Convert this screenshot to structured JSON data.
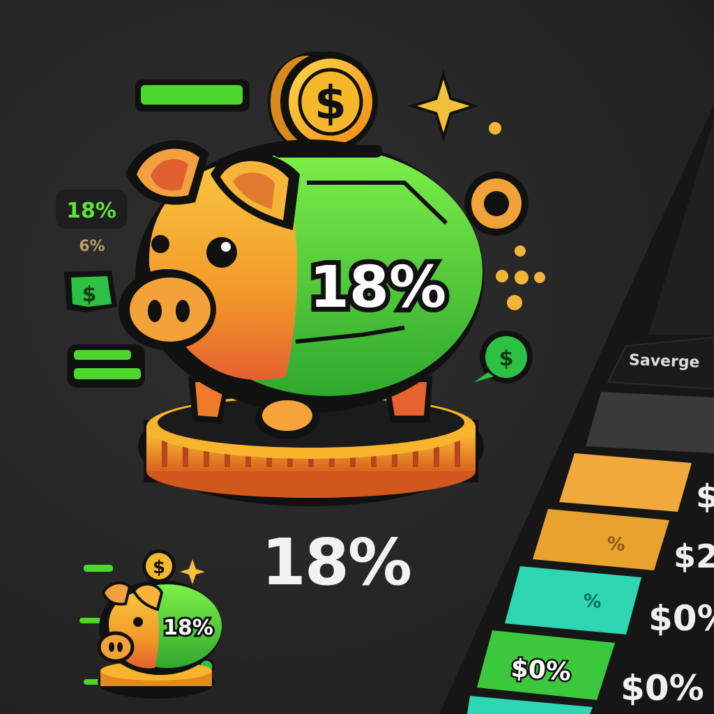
{
  "hero": {
    "badge_main": "18%",
    "badge_left_top": "18%",
    "badge_left_mid": "6%",
    "coin_symbol": "$",
    "bubble_symbol": "$"
  },
  "caption": {
    "value": "18%"
  },
  "thumbnail": {
    "badge": "18%",
    "coin_symbol": "$"
  },
  "savings_panel": {
    "title": "Saverge",
    "rows": [
      {
        "label": "",
        "amount": "$",
        "color": "#f2a93b"
      },
      {
        "label": "%",
        "amount": "$2",
        "color": "#e9a22f"
      },
      {
        "label": "%",
        "amount": "$0%",
        "color": "#2fd6b3"
      },
      {
        "label": "$0%",
        "amount": "$0%",
        "color": "#3cc83c"
      }
    ]
  },
  "colors": {
    "background": "#262626",
    "pig": "#f6b33a",
    "green": "#4fdc3c",
    "coin": "#f6b01d",
    "panel": "#141414"
  }
}
